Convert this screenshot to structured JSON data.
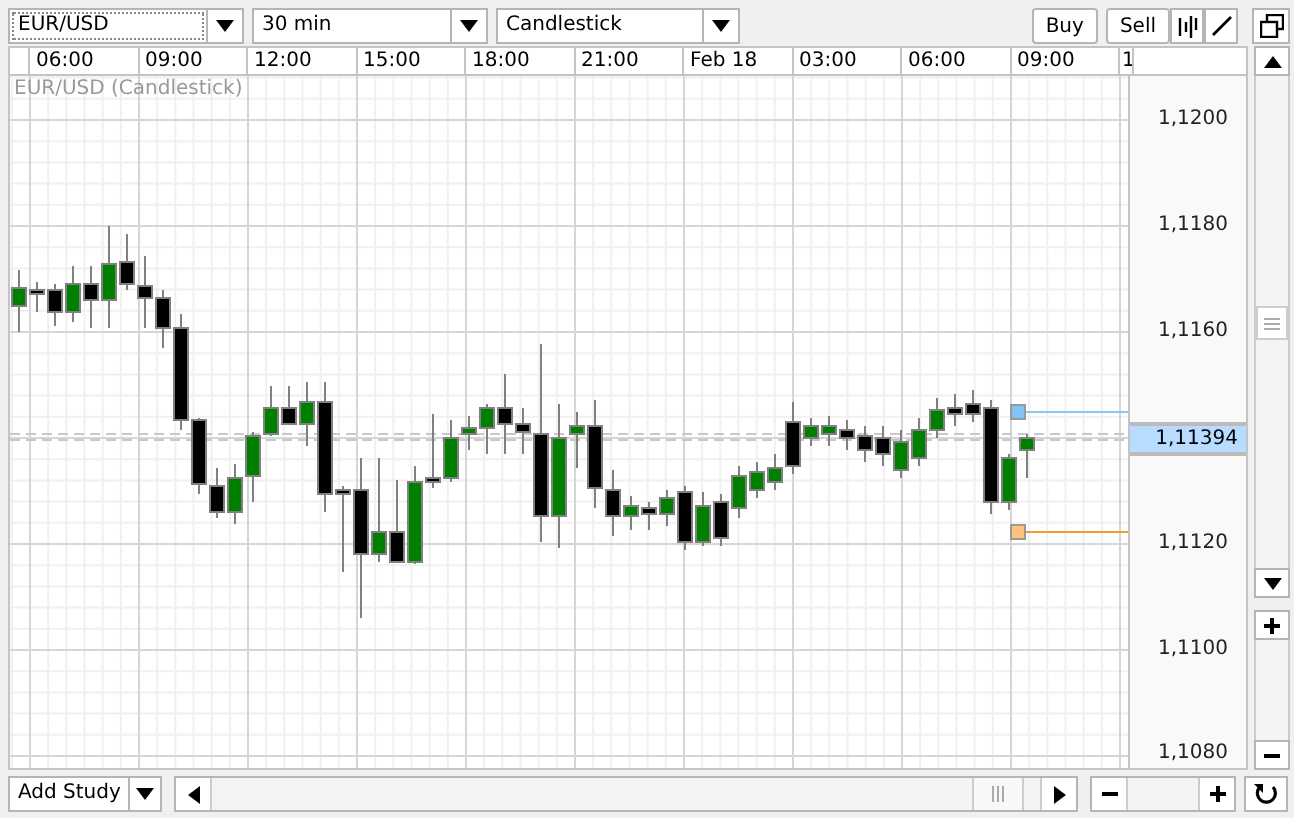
{
  "toolbar": {
    "symbol": {
      "value": "EUR/USD"
    },
    "interval": {
      "value": "30 min"
    },
    "chart_type": {
      "value": "Candlestick"
    },
    "buttons": [
      "Buy",
      "Sell"
    ]
  },
  "chart": {
    "legend": "EUR/USD (Candlestick)",
    "time_labels": [
      "06:00",
      "09:00",
      "12:00",
      "15:00",
      "18:00",
      "21:00",
      "Feb 18",
      "03:00",
      "06:00",
      "09:00",
      "1"
    ],
    "price_labels": [
      "1,1200",
      "1,1180",
      "1,1160",
      "1,1120",
      "1,1100",
      "1,1080"
    ],
    "current_price": "1,11394"
  },
  "bottom_bar": {
    "add_study": "Add Study"
  }
}
